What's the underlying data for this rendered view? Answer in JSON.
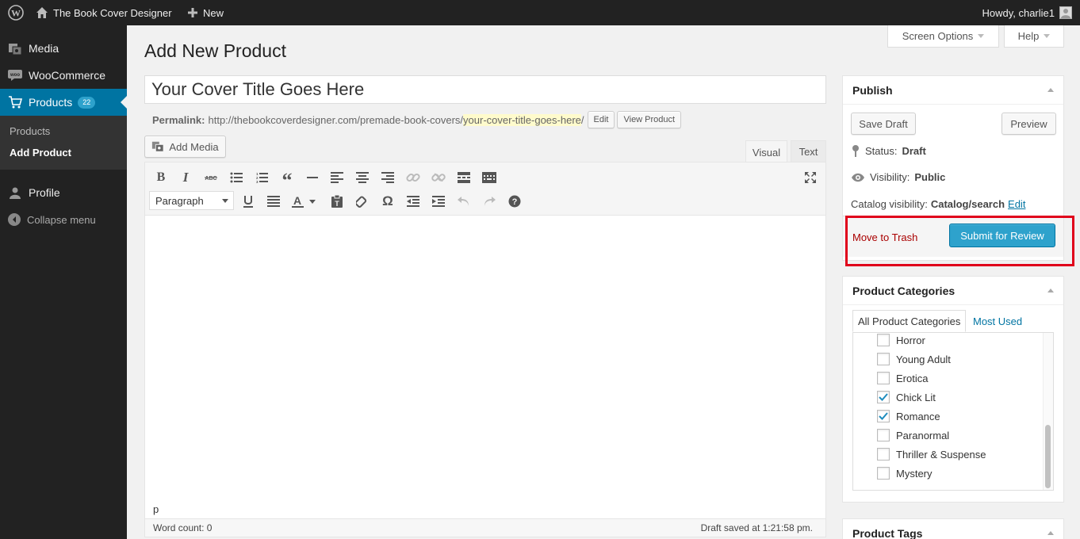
{
  "adminbar": {
    "site_name": "The Book Cover Designer",
    "new_label": "New",
    "howdy": "Howdy, charlie1",
    "icons": [
      "wordpress-logo-icon",
      "home-icon",
      "plus-icon",
      "avatar-icon"
    ]
  },
  "menu": {
    "items": [
      {
        "label": "Media",
        "icon": "media-icon"
      },
      {
        "label": "WooCommerce",
        "icon": "woo-icon"
      },
      {
        "label": "Products",
        "icon": "cart-icon",
        "count": "22"
      },
      {
        "label": "Profile",
        "icon": "user-icon"
      }
    ],
    "submenu": [
      "Products",
      "Add Product"
    ],
    "collapse_label": "Collapse menu"
  },
  "screen_options_label": "Screen Options",
  "help_label": "Help",
  "page_title": "Add New Product",
  "post_title_value": "Your Cover Title Goes Here",
  "permalink": {
    "label": "Permalink:",
    "base": "http://thebookcoverdesigner.com/premade-book-covers/",
    "slug": "your-cover-title-goes-here",
    "trail": "/",
    "edit_label": "Edit",
    "view_label": "View Product"
  },
  "editor": {
    "add_media_label": "Add Media",
    "tab_visual": "Visual",
    "tab_text": "Text",
    "format_value": "Paragraph",
    "toolbar_row1": [
      "bold-icon",
      "italic-icon",
      "strikethrough-icon",
      "bullet-list-icon",
      "numbered-list-icon",
      "blockquote-icon",
      "horizontal-rule-icon",
      "align-left-icon",
      "align-center-icon",
      "align-right-icon",
      "link-icon",
      "unlink-icon",
      "read-more-icon",
      "toolbar-toggle-icon"
    ],
    "toolbar_row2": [
      "underline-icon",
      "justify-icon",
      "text-color-icon",
      "paste-text-icon",
      "clear-formatting-icon",
      "special-character-icon",
      "outdent-icon",
      "indent-icon",
      "undo-icon",
      "redo-icon",
      "help-icon"
    ],
    "fullscreen_icon": "fullscreen-icon",
    "path": "p",
    "word_count": "Word count: 0",
    "draft_saved": "Draft saved at 1:21:58 pm."
  },
  "publish": {
    "title": "Publish",
    "save_draft_label": "Save Draft",
    "preview_label": "Preview",
    "status_label": "Status:",
    "status_value": "Draft",
    "visibility_label": "Visibility:",
    "visibility_value": "Public",
    "catalog_label": "Catalog visibility:",
    "catalog_value": "Catalog/search",
    "catalog_edit": "Edit",
    "trash_label": "Move to Trash",
    "submit_label": "Submit for Review",
    "highlight_color": "#e0001b"
  },
  "categories": {
    "title": "Product Categories",
    "tab_all": "All Product Categories",
    "tab_most_used": "Most Used",
    "items": [
      {
        "label": "Horror",
        "checked": false
      },
      {
        "label": "Young Adult",
        "checked": false
      },
      {
        "label": "Erotica",
        "checked": false
      },
      {
        "label": "Chick Lit",
        "checked": true
      },
      {
        "label": "Romance",
        "checked": true
      },
      {
        "label": "Paranormal",
        "checked": false
      },
      {
        "label": "Thriller & Suspense",
        "checked": false
      },
      {
        "label": "Mystery",
        "checked": false
      }
    ]
  },
  "tags": {
    "title": "Product Tags"
  },
  "colors": {
    "accent": "#0074a2",
    "admin_bar": "#222222",
    "button_primary": "#2ea2cc",
    "trash": "#aa0000"
  }
}
